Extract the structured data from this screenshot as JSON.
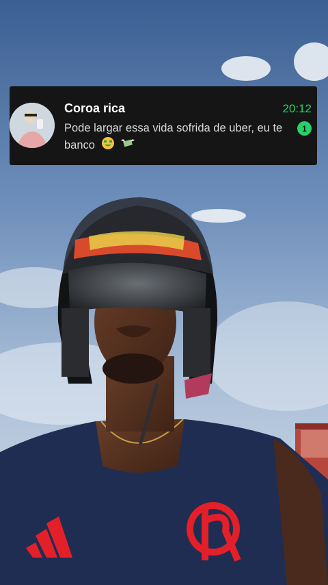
{
  "notification": {
    "sender": "Coroa rica",
    "time": "20:12",
    "message": "Pode largar essa vida sofrida de uber, eu te banco",
    "unread_count": "1",
    "emojis": [
      "money-mouth-face-icon",
      "flying-money-icon"
    ],
    "accent_color": "#25d366",
    "background_color": "#151515"
  },
  "scene": {
    "description_icons": [
      "helmet",
      "adidas-logo",
      "flamengo-crest"
    ],
    "jersey_color": "#1d2b4d",
    "crest_color": "#e3202a",
    "sky_color": "#4c6f9f"
  }
}
